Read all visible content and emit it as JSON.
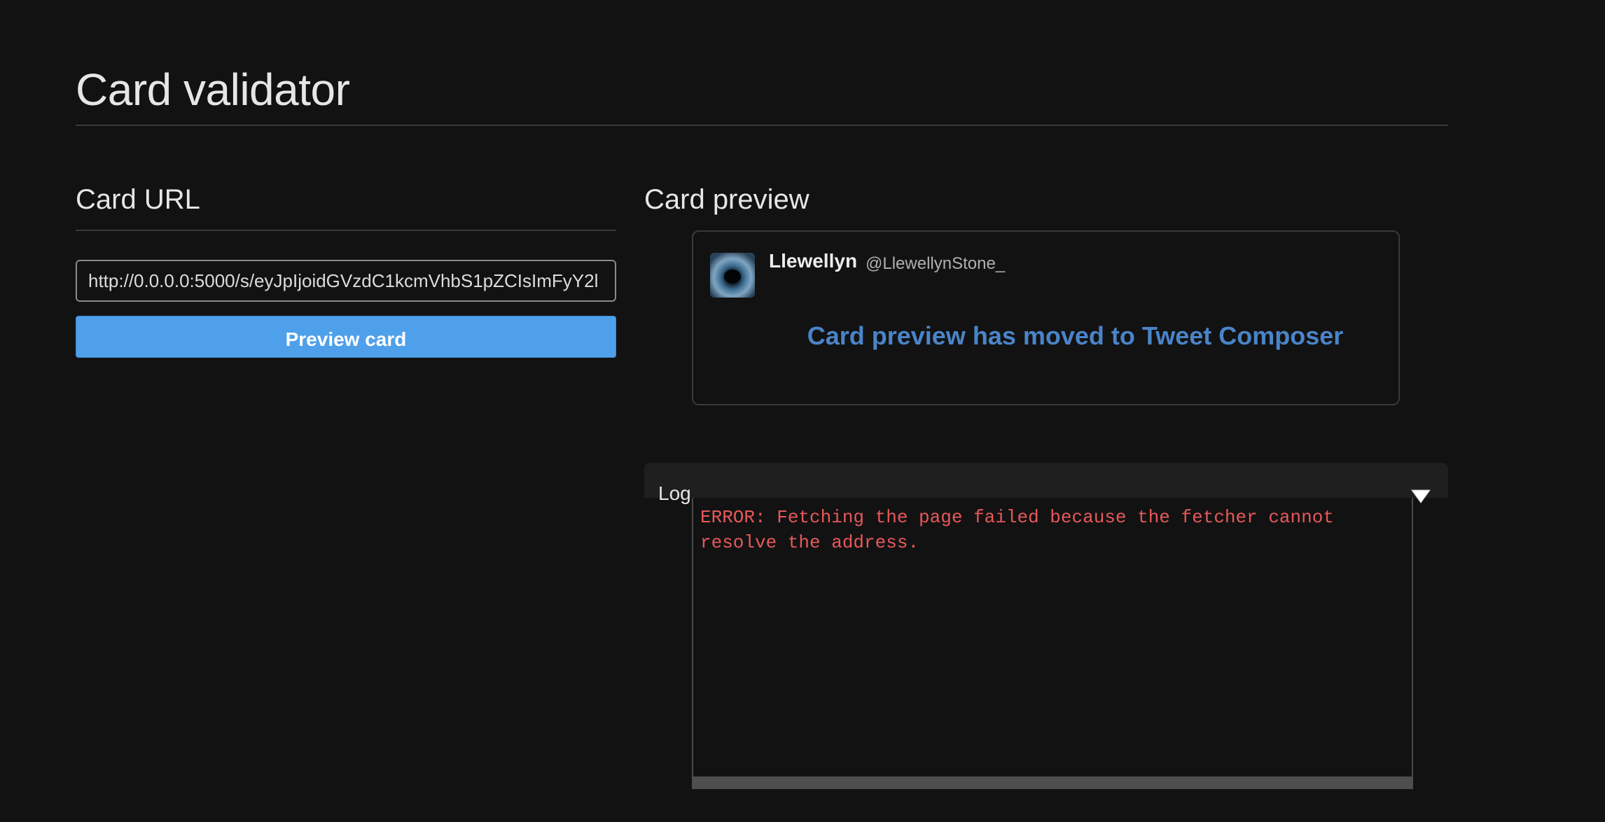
{
  "page": {
    "title": "Card validator"
  },
  "card_url": {
    "heading": "Card URL",
    "input_value": "http://0.0.0.0:5000/s/eyJpIjoidGVzdC1kcmVhbS1pZCIsImFyY2l",
    "button_label": "Preview card"
  },
  "card_preview": {
    "heading": "Card preview",
    "author_name": "Llewellyn",
    "author_handle": "@LlewellynStone_",
    "message": "Card preview has moved to Tweet Composer"
  },
  "log": {
    "label": "Log",
    "text": "ERROR: Fetching the page failed because the fetcher cannot\nresolve the address.",
    "error_color": "#e8585a"
  },
  "colors": {
    "background": "#121212",
    "button": "#4fa0ea",
    "link": "#4a84c8"
  },
  "icons": {
    "log_toggle": "triangle-down-icon",
    "avatar": "avatar"
  }
}
